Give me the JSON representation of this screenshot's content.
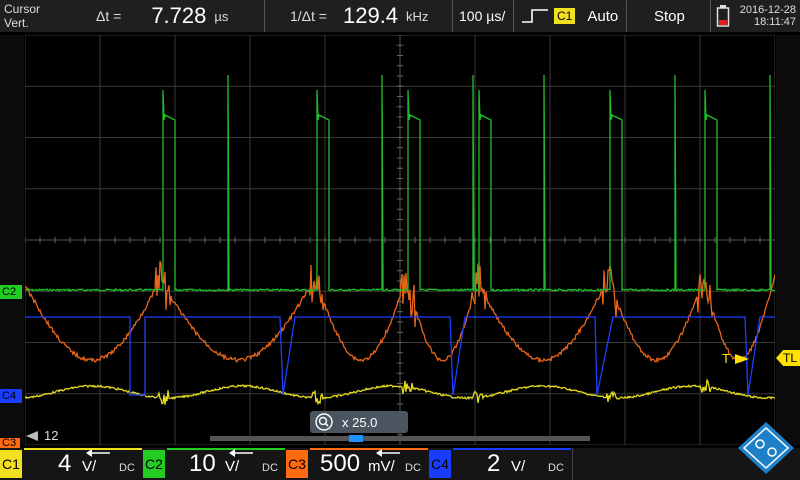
{
  "topbar": {
    "cursor_label": "Cursor",
    "cursor_mode": "Vert.",
    "dt_label": "Δt =",
    "dt_value": "7.728",
    "dt_unit": "µs",
    "inv_dt_label": "1/Δt =",
    "inv_dt_value": "129.4",
    "inv_dt_unit": "kHz",
    "timebase": "100 µs/",
    "trigger_source": "C1",
    "trigger_mode": "Auto",
    "run_state": "Stop",
    "date": "2016-12-28",
    "time": "18:11:47"
  },
  "markers": {
    "c2": "C2",
    "c4": "C4",
    "c3": "C3",
    "trigger_T": "T",
    "trigger_TL": "TL",
    "history": "12"
  },
  "zoom": {
    "label": "x 25.0",
    "position": 0.38
  },
  "channels": [
    {
      "name": "C1",
      "scale": "4",
      "unit": "V/",
      "coupling": "DC",
      "color": "#f0e020"
    },
    {
      "name": "C2",
      "scale": "10",
      "unit": "V/",
      "coupling": "DC",
      "color": "#22cc22"
    },
    {
      "name": "C3",
      "scale": "500",
      "unit": "mV/",
      "coupling": "DC",
      "color": "#ff6a10"
    },
    {
      "name": "C4",
      "scale": "2",
      "unit": "V/",
      "coupling": "DC",
      "color": "#1a3cff"
    }
  ],
  "colors": {
    "ch1": "#e6dc1e",
    "ch2": "#1fbf2a",
    "ch3": "#e8651a",
    "ch4": "#1f3fff",
    "trigger_marker": "#ffe000",
    "logo": "#1e80c8"
  },
  "logo_icon": "rs-diamond-logo-icon"
}
